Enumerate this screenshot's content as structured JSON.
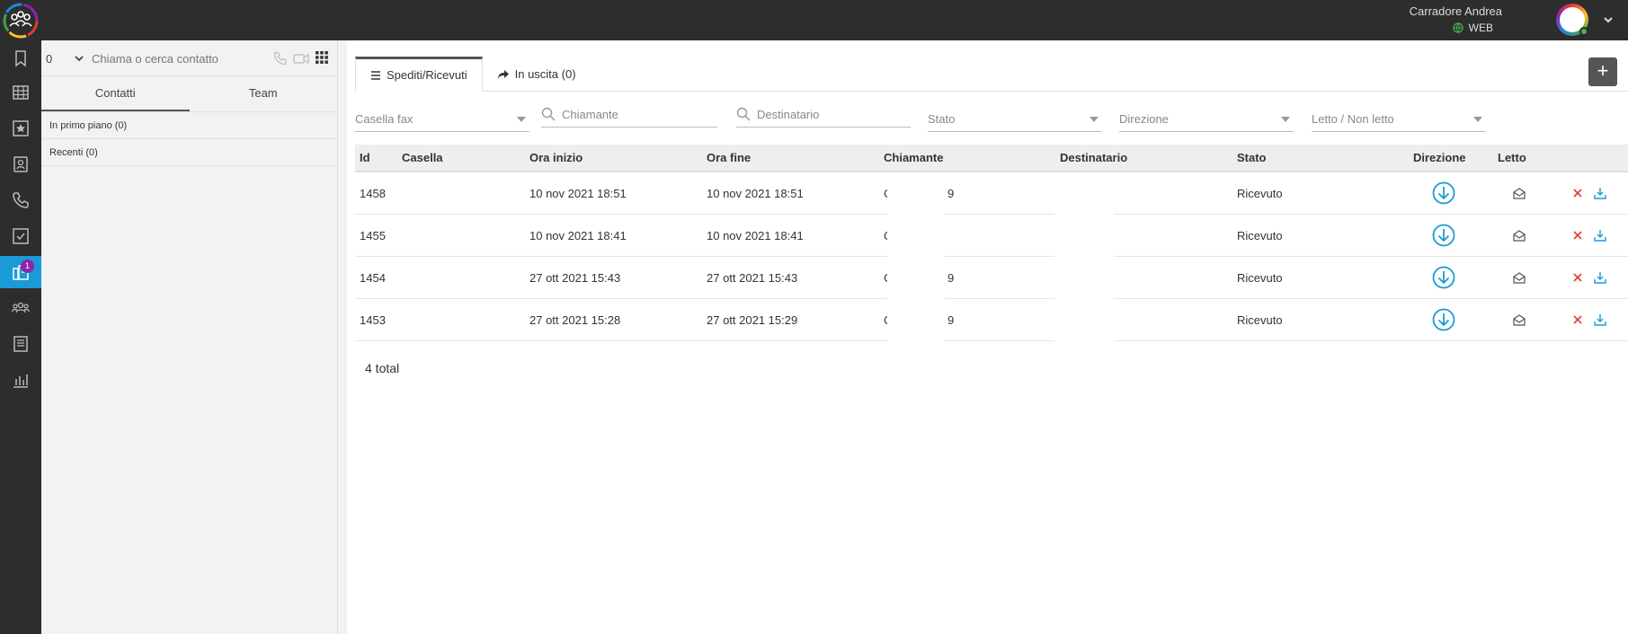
{
  "user": {
    "name": "Carradore Andrea",
    "presence": "WEB"
  },
  "rail": {
    "badge": "1"
  },
  "dialer": {
    "prefix": "0",
    "placeholder": "Chiama o cerca contatto"
  },
  "contacts": {
    "tabs": [
      "Contatti",
      "Team"
    ],
    "favorites": "In primo piano (0)",
    "recent": "Recenti (0)"
  },
  "main": {
    "tabs": [
      "Spediti/Ricevuti",
      "In uscita (0)"
    ],
    "add_label": "+",
    "filters": {
      "fax_box": "Casella fax",
      "caller": "Chiamante",
      "recipient": "Destinatario",
      "status": "Stato",
      "direction": "Direzione",
      "read": "Letto / Non letto"
    },
    "columns": [
      "Id",
      "Casella",
      "Ora inizio",
      "Ora fine",
      "Chiamante",
      "Destinatario",
      "Stato",
      "Direzione",
      "Letto"
    ],
    "rows": [
      {
        "id": "1458",
        "start": "10 nov 2021 18:51",
        "end": "10 nov 2021 18:51",
        "caller_a": "C",
        "caller_b": "9",
        "status": "Ricevuto"
      },
      {
        "id": "1455",
        "start": "10 nov 2021 18:41",
        "end": "10 nov 2021 18:41",
        "caller_a": "C",
        "caller_b": "",
        "status": "Ricevuto"
      },
      {
        "id": "1454",
        "start": "27 ott 2021 15:43",
        "end": "27 ott 2021 15:43",
        "caller_a": "C",
        "caller_b": "9",
        "status": "Ricevuto"
      },
      {
        "id": "1453",
        "start": "27 ott 2021 15:28",
        "end": "27 ott 2021 15:29",
        "caller_a": "C",
        "caller_b": "9",
        "status": "Ricevuto"
      }
    ],
    "total": "4 total"
  },
  "colors": {
    "accent": "#1a9ad6",
    "delete": "#e53935",
    "badge": "#8e24aa"
  }
}
